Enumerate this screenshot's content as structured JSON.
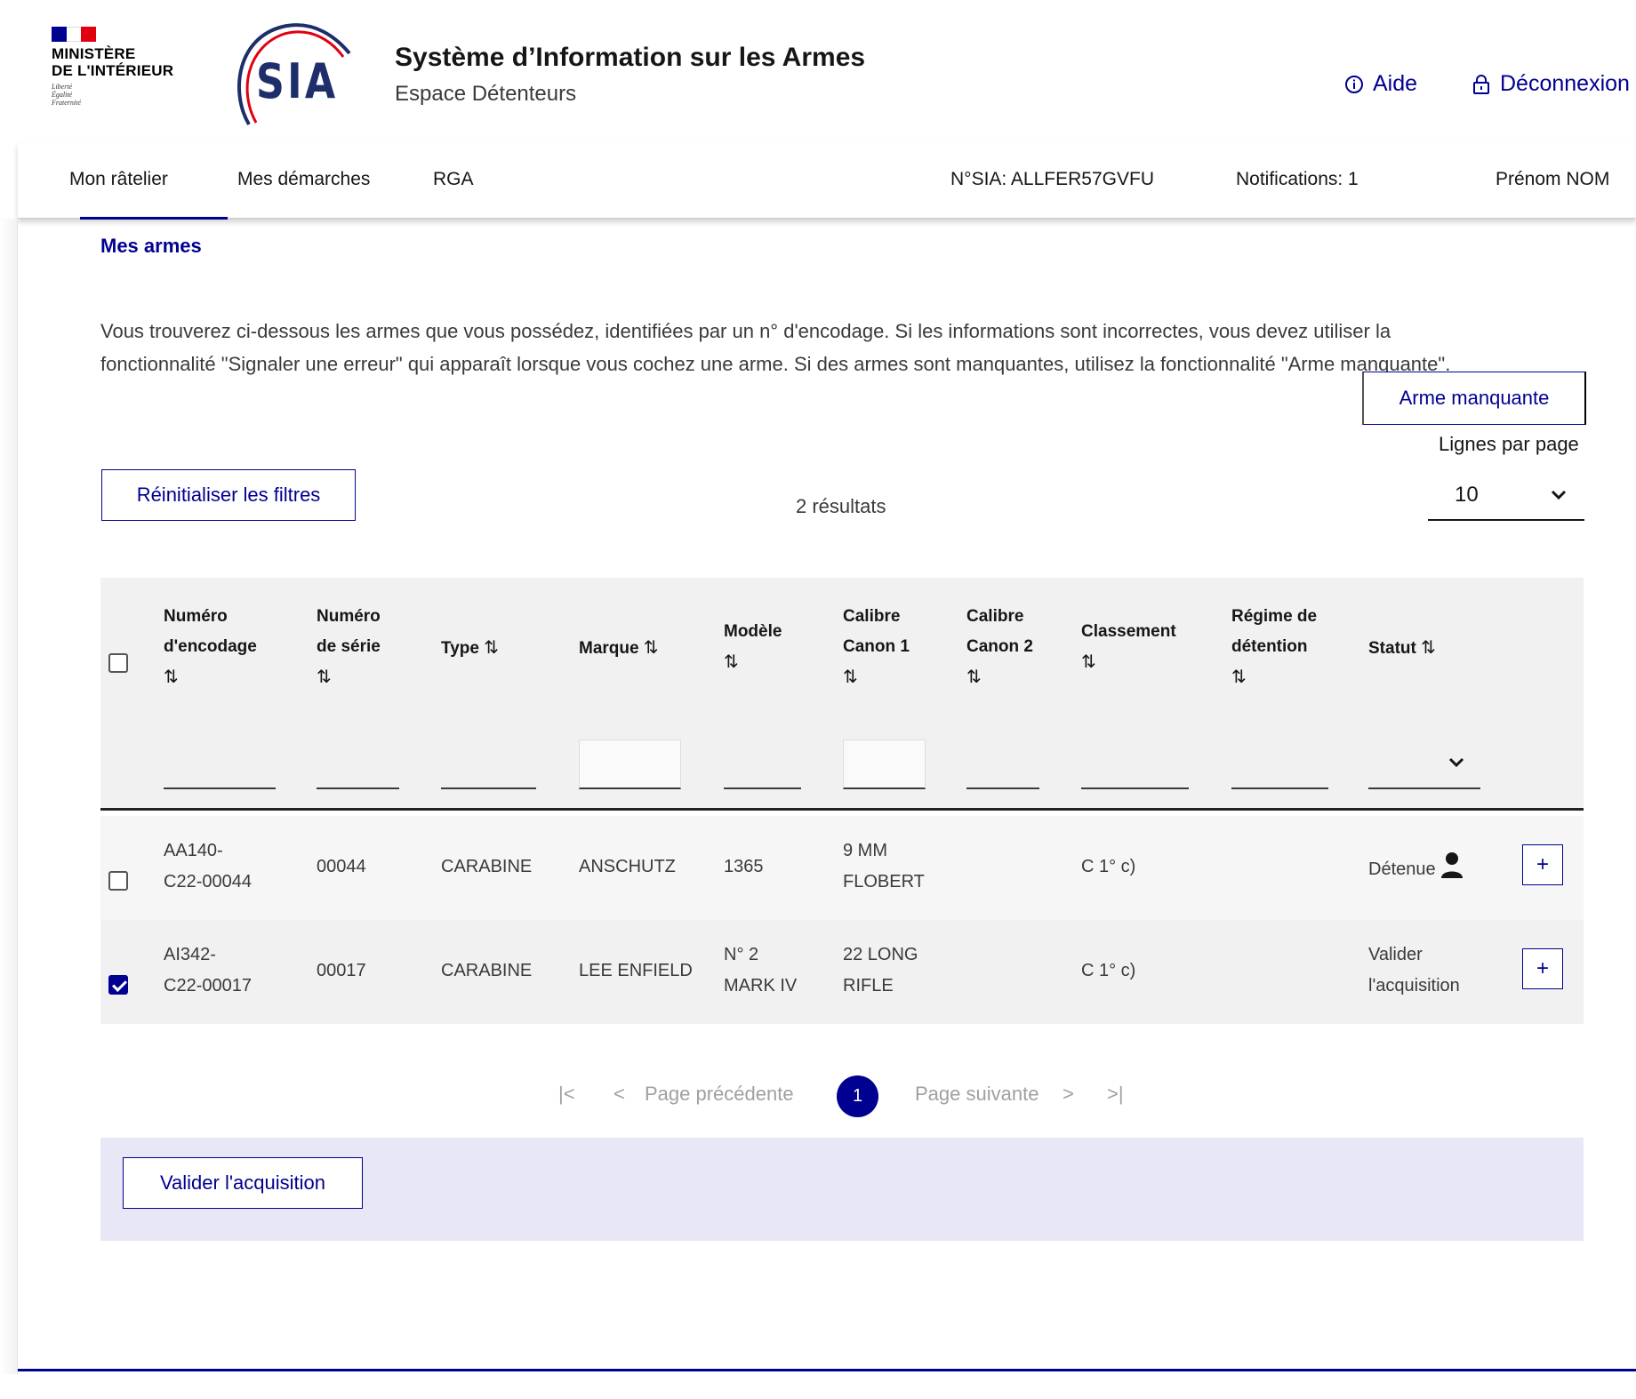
{
  "header": {
    "ministry_line1": "MINISTÈRE",
    "ministry_line2": "DE L'INTÉRIEUR",
    "motto_1": "Liberté",
    "motto_2": "Égalité",
    "motto_3": "Fraternité",
    "logo_text": "SIA",
    "title": "Système d’Information sur les Armes",
    "subtitle": "Espace Détenteurs",
    "help_label": "Aide",
    "logout_label": "Déconnexion",
    "colors": {
      "flag_blue": "#000091",
      "flag_white": "#ffffff",
      "flag_red": "#e1000f",
      "logo_arc": "#e1000f",
      "logo_text": "#1d2e6b"
    }
  },
  "nav": {
    "items": [
      "Mon râtelier",
      "Mes démarches",
      "RGA"
    ],
    "sia_number": "N°SIA: ALLFER57GVFU",
    "notifications": "Notifications: 1",
    "user_name": "Prénom NOM"
  },
  "breadcrumb": "Mes armes",
  "intro": {
    "line1": "Vous trouverez ci-dessous les armes que vous possédez, identifiées par un n° d'encodage. Si les informations sont incorrectes, vous devez utiliser la",
    "line2": "fonctionnalité \"Signaler une erreur\" qui apparaît lorsque vous cochez une arme. Si des armes sont manquantes, utilisez la fonctionnalité \"Arme manquante\"."
  },
  "toolbar": {
    "missing_button": "Arme manquante",
    "lines_per_page_label": "Lignes par page",
    "lines_per_page_value": "10",
    "reset_button": "Réinitialiser les filtres",
    "results": "2 résultats"
  },
  "table": {
    "sort_icon": "⇅",
    "columns": {
      "encodage": {
        "l1": "Numéro",
        "l2": "d'encodage"
      },
      "serie": {
        "l1": "Numéro",
        "l2": "de série"
      },
      "type": "Type",
      "marque": "Marque",
      "modele": "Modèle",
      "calibre1": {
        "l1": "Calibre",
        "l2": "Canon 1"
      },
      "calibre2": {
        "l1": "Calibre",
        "l2": "Canon 2"
      },
      "classement": "Classement",
      "regime": {
        "l1": "Régime de",
        "l2": "détention"
      },
      "statut": "Statut"
    },
    "rows": [
      {
        "checked": false,
        "encodage": {
          "l1": "AA140-",
          "l2": "C22-00044"
        },
        "serie": "00044",
        "type": "CARABINE",
        "marque": "ANSCHUTZ",
        "modele": {
          "l1": "1365",
          "l2": ""
        },
        "calibre1": {
          "l1": "9 MM",
          "l2": "FLOBERT"
        },
        "calibre2": "",
        "classement": "C 1° c)",
        "regime": "",
        "statut": {
          "l1": "Détenue",
          "l2": ""
        }
      },
      {
        "checked": true,
        "encodage": {
          "l1": "AI342-",
          "l2": "C22-00017"
        },
        "serie": "00017",
        "type": "CARABINE",
        "marque": "LEE ENFIELD",
        "modele": {
          "l1": "N° 2",
          "l2": "MARK IV"
        },
        "calibre1": {
          "l1": "22 LONG",
          "l2": "RIFLE"
        },
        "calibre2": "",
        "classement": "C 1° c)",
        "regime": "",
        "statut": {
          "l1": "Valider",
          "l2": "l'acquisition"
        }
      }
    ],
    "row_action": "+"
  },
  "pagination": {
    "first": "|<",
    "prev_arrow": "<",
    "prev_label": "Page précédente",
    "current": "1",
    "next_label": "Page suivante",
    "next_arrow": ">",
    "last": ">|"
  },
  "actions": {
    "validate_button": "Valider l'acquisition"
  }
}
